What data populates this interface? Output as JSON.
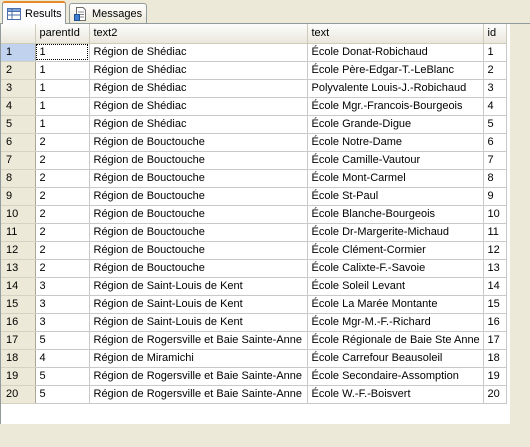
{
  "tabs": {
    "results_label": "Results",
    "messages_label": "Messages"
  },
  "columns": {
    "parentId": "parentId",
    "text2": "text2",
    "text": "text",
    "id": "id"
  },
  "rows": [
    {
      "num": "1",
      "parentId": "1",
      "text2": "Région de Shédiac",
      "text": "École Donat-Robichaud",
      "id": "1"
    },
    {
      "num": "2",
      "parentId": "1",
      "text2": "Région de Shédiac",
      "text": "École Père-Edgar-T.-LeBlanc",
      "id": "2"
    },
    {
      "num": "3",
      "parentId": "1",
      "text2": "Région de Shédiac",
      "text": "Polyvalente Louis-J.-Robichaud",
      "id": "3"
    },
    {
      "num": "4",
      "parentId": "1",
      "text2": "Région de Shédiac",
      "text": "École Mgr.-Francois-Bourgeois",
      "id": "4"
    },
    {
      "num": "5",
      "parentId": "1",
      "text2": "Région de Shédiac",
      "text": "École Grande-Digue",
      "id": "5"
    },
    {
      "num": "6",
      "parentId": "2",
      "text2": "Région de Bouctouche",
      "text": "École Notre-Dame",
      "id": "6"
    },
    {
      "num": "7",
      "parentId": "2",
      "text2": "Région de Bouctouche",
      "text": "École Camille-Vautour",
      "id": "7"
    },
    {
      "num": "8",
      "parentId": "2",
      "text2": "Région de Bouctouche",
      "text": "École Mont-Carmel",
      "id": "8"
    },
    {
      "num": "9",
      "parentId": "2",
      "text2": "Région de Bouctouche",
      "text": "École St-Paul",
      "id": "9"
    },
    {
      "num": "10",
      "parentId": "2",
      "text2": "Région de Bouctouche",
      "text": "École Blanche-Bourgeois",
      "id": "10"
    },
    {
      "num": "11",
      "parentId": "2",
      "text2": "Région de Bouctouche",
      "text": "École Dr-Margerite-Michaud",
      "id": "11"
    },
    {
      "num": "12",
      "parentId": "2",
      "text2": "Région de Bouctouche",
      "text": "École Clément-Cormier",
      "id": "12"
    },
    {
      "num": "13",
      "parentId": "2",
      "text2": "Région de Bouctouche",
      "text": "École Calixte-F.-Savoie",
      "id": "13"
    },
    {
      "num": "14",
      "parentId": "3",
      "text2": "Région de Saint-Louis de Kent",
      "text": "École Soleil Levant",
      "id": "14"
    },
    {
      "num": "15",
      "parentId": "3",
      "text2": "Région de Saint-Louis de Kent",
      "text": "École La Marée Montante",
      "id": "15"
    },
    {
      "num": "16",
      "parentId": "3",
      "text2": "Région de Saint-Louis de Kent",
      "text": "École Mgr-M.-F.-Richard",
      "id": "16"
    },
    {
      "num": "17",
      "parentId": "5",
      "text2": "Région de Rogersville et Baie Sainte-Anne",
      "text": "École Régionale de Baie Ste Anne",
      "id": "17"
    },
    {
      "num": "18",
      "parentId": "4",
      "text2": "Région de Miramichi",
      "text": "École Carrefour Beausoleil",
      "id": "18"
    },
    {
      "num": "19",
      "parentId": "5",
      "text2": "Région de Rogersville et Baie Sainte-Anne",
      "text": "École Secondaire-Assomption",
      "id": "19"
    },
    {
      "num": "20",
      "parentId": "5",
      "text2": "Région de Rogersville et Baie Sainte-Anne",
      "text": "École W.-F.-Boisvert",
      "id": "20"
    }
  ],
  "icons": {
    "results": "grid-icon",
    "messages": "document-icon"
  },
  "colors": {
    "active_tab_accent": "#e68b2c",
    "selected_row_header": "#c1d2ee"
  }
}
